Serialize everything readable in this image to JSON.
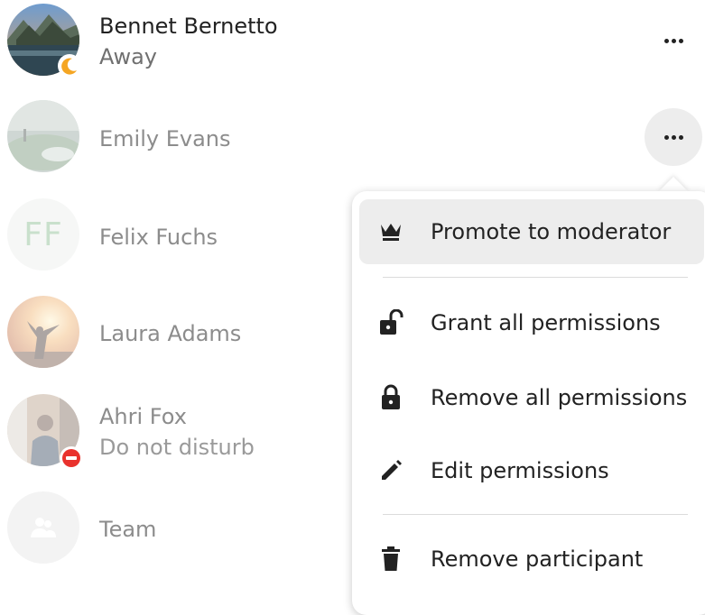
{
  "participants": [
    {
      "name": "Bennet Bernetto",
      "status": "Away"
    },
    {
      "name": "Emily Evans",
      "status": ""
    },
    {
      "name": "Felix Fuchs",
      "status": "",
      "initials": "FF"
    },
    {
      "name": "Laura Adams",
      "status": ""
    },
    {
      "name": "Ahri Fox",
      "status": "Do not disturb"
    },
    {
      "name": "Team",
      "status": ""
    }
  ],
  "menu": {
    "items": [
      {
        "label": "Promote to moderator",
        "icon": "crown-icon"
      },
      {
        "label": "Grant all permissions",
        "icon": "lock-open-icon"
      },
      {
        "label": "Remove all permissions",
        "icon": "lock-icon"
      },
      {
        "label": "Edit permissions",
        "icon": "pencil-icon"
      },
      {
        "label": "Remove participant",
        "icon": "trash-icon"
      }
    ]
  },
  "colors": {
    "away": "#f5a623",
    "dnd": "#e9322d",
    "menu_hover": "#ededed"
  }
}
